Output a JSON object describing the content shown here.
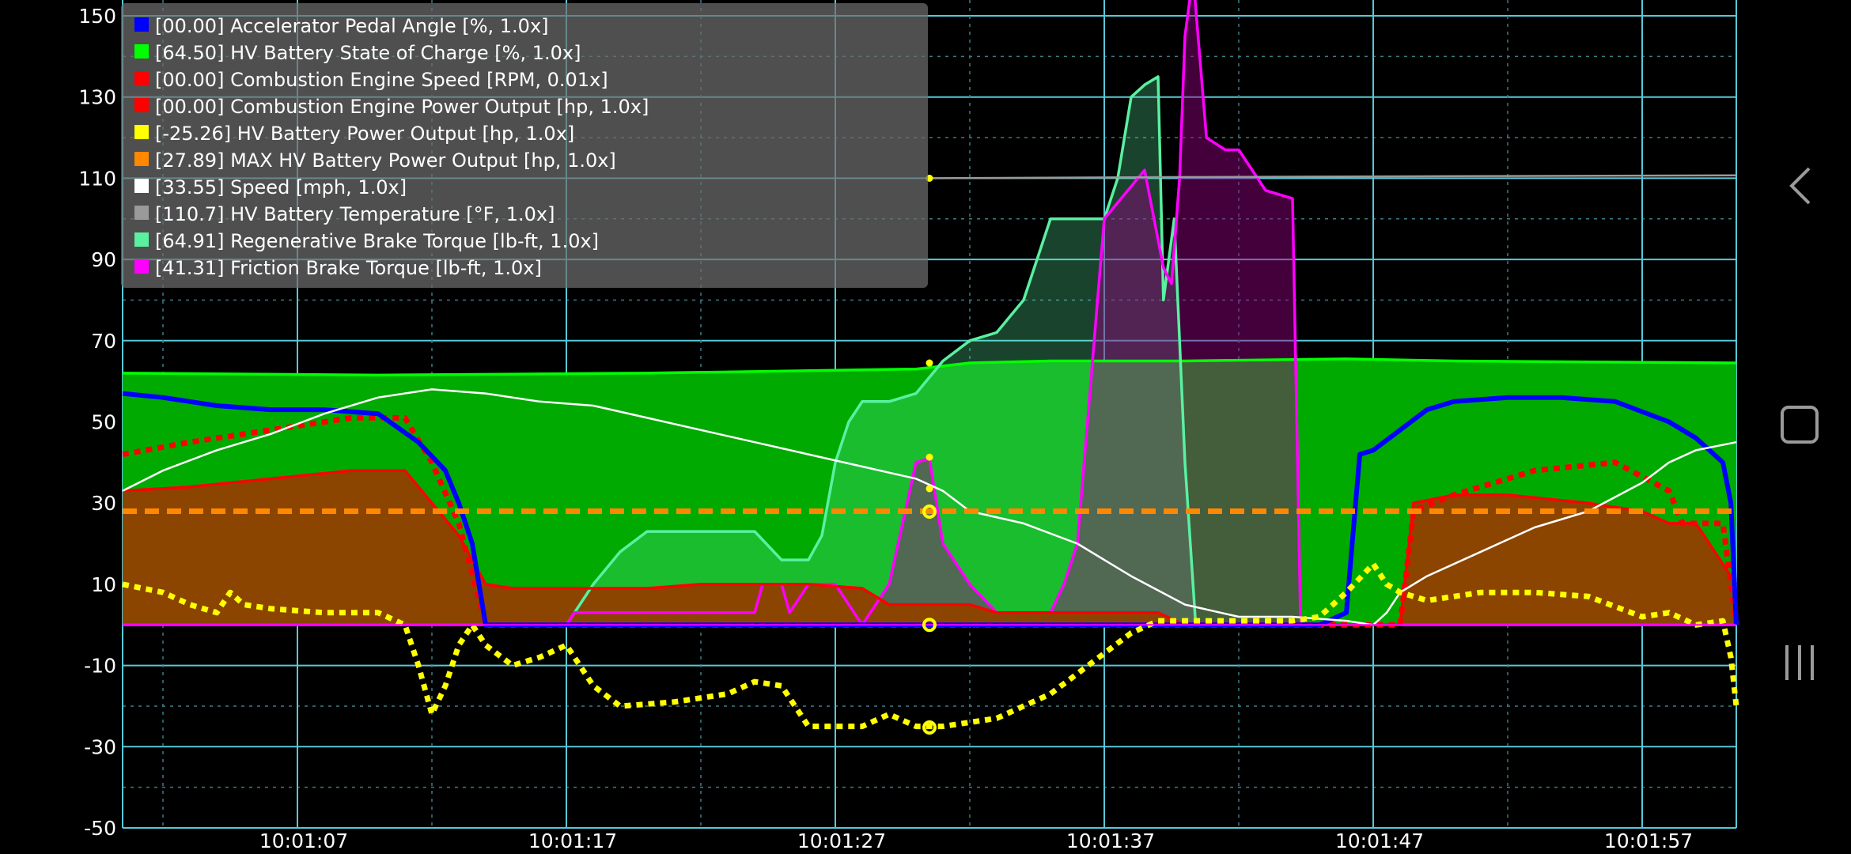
{
  "chart_data": {
    "type": "area",
    "ylim": [
      -50,
      150
    ],
    "yticks": [
      "-50",
      "-30",
      "-10",
      "10",
      "30",
      "50",
      "70",
      "90",
      "110",
      "130",
      "150"
    ],
    "x_ticks": [
      "10:01:07",
      "10:01:17",
      "10:01:27",
      "10:01:37",
      "10:01:47",
      "10:01:57"
    ],
    "x_range_s": [
      0.5,
      60.5
    ],
    "x_major_s": [
      7,
      17,
      27,
      37,
      47,
      57
    ],
    "cursor_s": 30.5,
    "grid": true,
    "legend_position": "top-left",
    "series": [
      {
        "name": "[64.50] HV Battery State of Charge [%, 1.0x]",
        "color": "#00ff00",
        "fill": "#00aa00",
        "style": "area",
        "points": [
          [
            0.5,
            62
          ],
          [
            10,
            61.5
          ],
          [
            20,
            62
          ],
          [
            30,
            63
          ],
          [
            32,
            64.5
          ],
          [
            35,
            65
          ],
          [
            40,
            65
          ],
          [
            46,
            65.5
          ],
          [
            50,
            65
          ],
          [
            60.5,
            64.5
          ]
        ]
      },
      {
        "name": "[64.91] Regenerative Brake Torque [lb-ft, 1.0x]",
        "color": "#5af0a0",
        "fill": "rgba(90,240,160,0.28)",
        "style": "area",
        "points": [
          [
            0.5,
            0
          ],
          [
            17,
            0
          ],
          [
            17.5,
            5
          ],
          [
            18,
            10
          ],
          [
            19,
            18
          ],
          [
            20,
            23
          ],
          [
            24,
            23
          ],
          [
            25,
            16
          ],
          [
            26,
            16
          ],
          [
            26.5,
            22
          ],
          [
            27,
            40
          ],
          [
            27.5,
            50
          ],
          [
            28,
            55
          ],
          [
            29,
            55
          ],
          [
            30,
            57
          ],
          [
            31,
            65
          ],
          [
            32,
            70
          ],
          [
            33,
            72
          ],
          [
            34,
            80
          ],
          [
            35,
            100
          ],
          [
            36,
            100
          ],
          [
            37,
            100
          ],
          [
            37.5,
            110
          ],
          [
            38,
            130
          ],
          [
            38.5,
            133
          ],
          [
            39,
            135
          ],
          [
            39.2,
            80
          ],
          [
            39.6,
            100
          ],
          [
            40,
            40
          ],
          [
            40.4,
            0
          ],
          [
            60.5,
            0
          ]
        ]
      },
      {
        "name": "[41.31] Friction Brake Torque [lb-ft, 1.0x]",
        "color": "#ff00ff",
        "fill": "rgba(150,0,130,0.45)",
        "style": "area",
        "points": [
          [
            0.5,
            0
          ],
          [
            17,
            0
          ],
          [
            17.3,
            3
          ],
          [
            24,
            3
          ],
          [
            24.3,
            10
          ],
          [
            25,
            10
          ],
          [
            25.3,
            3
          ],
          [
            26,
            10
          ],
          [
            27,
            10
          ],
          [
            27.5,
            5
          ],
          [
            28,
            0
          ],
          [
            29,
            10
          ],
          [
            30,
            40
          ],
          [
            30.5,
            41
          ],
          [
            31,
            20
          ],
          [
            32,
            10
          ],
          [
            33,
            3
          ],
          [
            35,
            3
          ],
          [
            35.5,
            10
          ],
          [
            36,
            20
          ],
          [
            37,
            100
          ],
          [
            38,
            108
          ],
          [
            38.5,
            112
          ],
          [
            39.2,
            88
          ],
          [
            39.5,
            84
          ],
          [
            39.8,
            110
          ],
          [
            40,
            145
          ],
          [
            40.3,
            160
          ],
          [
            40.8,
            120
          ],
          [
            41.5,
            117
          ],
          [
            42,
            117
          ],
          [
            43,
            107
          ],
          [
            44,
            105
          ],
          [
            44.3,
            0
          ],
          [
            60.5,
            0
          ]
        ]
      },
      {
        "name": "[00.00] Combustion Engine Power Output [hp, 1.0x]",
        "color": "#ff0000",
        "fill": "#8b4500",
        "style": "area",
        "points": [
          [
            0.5,
            33
          ],
          [
            3,
            34
          ],
          [
            6,
            36
          ],
          [
            9,
            38
          ],
          [
            11,
            38
          ],
          [
            12,
            30
          ],
          [
            13,
            22
          ],
          [
            14,
            10
          ],
          [
            15,
            9
          ],
          [
            17,
            9
          ],
          [
            20,
            9
          ],
          [
            22,
            10
          ],
          [
            24,
            10
          ],
          [
            26,
            10
          ],
          [
            28,
            9
          ],
          [
            29,
            5
          ],
          [
            30,
            5
          ],
          [
            32,
            5
          ],
          [
            33,
            3
          ],
          [
            35,
            3
          ],
          [
            37,
            3
          ],
          [
            38,
            3
          ],
          [
            39,
            3
          ],
          [
            40,
            0
          ],
          [
            43,
            0
          ],
          [
            45,
            0
          ],
          [
            46,
            0
          ],
          [
            47,
            0
          ],
          [
            48,
            0
          ],
          [
            48.5,
            30
          ],
          [
            50,
            32
          ],
          [
            52,
            32
          ],
          [
            55,
            30
          ],
          [
            57,
            28
          ],
          [
            58,
            25
          ],
          [
            59,
            25
          ],
          [
            60.5,
            10
          ]
        ]
      },
      {
        "name": "[00.00] Combustion Engine Speed [RPM, 0.01x]",
        "color": "#ff0000",
        "style": "dotted",
        "points": [
          [
            0.5,
            42
          ],
          [
            3,
            45
          ],
          [
            6,
            48
          ],
          [
            9,
            51
          ],
          [
            11,
            51
          ],
          [
            12,
            40
          ],
          [
            13,
            25
          ],
          [
            14,
            0
          ],
          [
            30,
            0
          ],
          [
            45,
            0
          ],
          [
            47,
            0
          ],
          [
            48,
            0
          ],
          [
            48.5,
            28
          ],
          [
            50,
            32
          ],
          [
            53,
            38
          ],
          [
            56,
            40
          ],
          [
            58,
            33
          ],
          [
            58.5,
            25
          ],
          [
            60,
            25
          ],
          [
            60.5,
            0
          ]
        ]
      },
      {
        "name": "[00.00] Accelerator Pedal Angle [%, 1.0x]",
        "color": "#0000ff",
        "style": "line",
        "points": [
          [
            0.5,
            57
          ],
          [
            2,
            56
          ],
          [
            4,
            54
          ],
          [
            6,
            53
          ],
          [
            8,
            53
          ],
          [
            10,
            52
          ],
          [
            11.5,
            45
          ],
          [
            12.5,
            38
          ],
          [
            13,
            30
          ],
          [
            13.5,
            20
          ],
          [
            14,
            0
          ],
          [
            45,
            0
          ],
          [
            46,
            3
          ],
          [
            46.5,
            42
          ],
          [
            47,
            43
          ],
          [
            48,
            48
          ],
          [
            49,
            53
          ],
          [
            50,
            55
          ],
          [
            52,
            56
          ],
          [
            54,
            56
          ],
          [
            56,
            55
          ],
          [
            58,
            50
          ],
          [
            59,
            46
          ],
          [
            60,
            40
          ],
          [
            60.3,
            30
          ],
          [
            60.5,
            0
          ]
        ]
      },
      {
        "name": "[33.55] Speed [mph, 1.0x]",
        "color": "#ffffff",
        "style": "line",
        "points": [
          [
            0.5,
            33
          ],
          [
            2,
            38
          ],
          [
            4,
            43
          ],
          [
            6,
            47
          ],
          [
            8,
            52
          ],
          [
            10,
            56
          ],
          [
            12,
            58
          ],
          [
            14,
            57
          ],
          [
            16,
            55
          ],
          [
            18,
            54
          ],
          [
            20,
            51
          ],
          [
            22,
            48
          ],
          [
            24,
            45
          ],
          [
            26,
            42
          ],
          [
            28,
            39
          ],
          [
            30,
            36
          ],
          [
            31,
            33
          ],
          [
            32,
            28
          ],
          [
            34,
            25
          ],
          [
            36,
            20
          ],
          [
            38,
            12
          ],
          [
            40,
            5
          ],
          [
            42,
            2
          ],
          [
            44,
            2
          ],
          [
            46,
            1
          ],
          [
            47,
            0
          ],
          [
            47.5,
            3
          ],
          [
            48,
            8
          ],
          [
            49,
            12
          ],
          [
            51,
            18
          ],
          [
            53,
            24
          ],
          [
            55,
            28
          ],
          [
            57,
            35
          ],
          [
            58,
            40
          ],
          [
            59,
            43
          ],
          [
            60.5,
            45
          ]
        ]
      },
      {
        "name": "[-25.26] HV Battery Power Output [hp, 1.0x]",
        "color": "#ffff00",
        "style": "dotted",
        "points": [
          [
            0.5,
            10
          ],
          [
            2,
            8
          ],
          [
            3,
            5
          ],
          [
            4,
            3
          ],
          [
            4.5,
            8
          ],
          [
            5,
            5
          ],
          [
            6,
            4
          ],
          [
            8,
            3
          ],
          [
            10,
            3
          ],
          [
            11,
            0
          ],
          [
            11.5,
            -10
          ],
          [
            12,
            -22
          ],
          [
            12.5,
            -15
          ],
          [
            13,
            -5
          ],
          [
            13.5,
            0
          ],
          [
            14,
            -5
          ],
          [
            15,
            -10
          ],
          [
            16,
            -8
          ],
          [
            17,
            -5
          ],
          [
            18,
            -15
          ],
          [
            19,
            -20
          ],
          [
            21,
            -19
          ],
          [
            23,
            -17
          ],
          [
            24,
            -14
          ],
          [
            25,
            -15
          ],
          [
            26,
            -25
          ],
          [
            27,
            -25
          ],
          [
            28,
            -25
          ],
          [
            29,
            -22
          ],
          [
            30,
            -25
          ],
          [
            31,
            -25
          ],
          [
            32,
            -24
          ],
          [
            33,
            -23
          ],
          [
            34,
            -20
          ],
          [
            35,
            -17
          ],
          [
            36,
            -12
          ],
          [
            37,
            -7
          ],
          [
            38,
            -2
          ],
          [
            39,
            1
          ],
          [
            41,
            1
          ],
          [
            43,
            1
          ],
          [
            44,
            1
          ],
          [
            45,
            2
          ],
          [
            46,
            8
          ],
          [
            47,
            15
          ],
          [
            47.5,
            10
          ],
          [
            48,
            8
          ],
          [
            49,
            6
          ],
          [
            51,
            8
          ],
          [
            53,
            8
          ],
          [
            55,
            7
          ],
          [
            57,
            2
          ],
          [
            58,
            3
          ],
          [
            59,
            0
          ],
          [
            60,
            1
          ],
          [
            60.3,
            -8
          ],
          [
            60.5,
            -20
          ]
        ]
      },
      {
        "name": "[27.89] MAX HV Battery Power Output [hp, 1.0x]",
        "color": "#ff8800",
        "style": "dashed",
        "points": [
          [
            0.5,
            28
          ],
          [
            60.5,
            28
          ]
        ]
      },
      {
        "name": "[110.7] HV Battery Temperature [°F, 1.0x]",
        "color": "#9a9a9a",
        "style": "line",
        "points": [
          [
            30.5,
            110
          ],
          [
            40,
            110.3
          ],
          [
            50,
            110.5
          ],
          [
            60.5,
            110.7
          ]
        ]
      }
    ],
    "legend": [
      {
        "label": "[00.00] Accelerator Pedal Angle [%, 1.0x]",
        "color": "#0000ff"
      },
      {
        "label": "[64.50] HV Battery State of Charge [%, 1.0x]",
        "color": "#00ff00"
      },
      {
        "label": "[00.00] Combustion Engine Speed [RPM, 0.01x]",
        "color": "#ff0000"
      },
      {
        "label": "[00.00] Combustion Engine Power Output [hp, 1.0x]",
        "color": "#ff0000"
      },
      {
        "label": "[-25.26] HV Battery Power Output [hp, 1.0x]",
        "color": "#ffff00"
      },
      {
        "label": "[27.89] MAX HV Battery Power Output [hp, 1.0x]",
        "color": "#ff8800"
      },
      {
        "label": "[33.55] Speed [mph, 1.0x]",
        "color": "#ffffff"
      },
      {
        "label": "[110.7] HV Battery Temperature [°F, 1.0x]",
        "color": "#9a9a9a"
      },
      {
        "label": "[64.91] Regenerative Brake Torque [lb-ft, 1.0x]",
        "color": "#5af0a0"
      },
      {
        "label": "[41.31] Friction Brake Torque [lb-ft, 1.0x]",
        "color": "#ff00ff"
      }
    ],
    "cursor_markers": [
      {
        "value": 110,
        "series": "HV Battery Temperature"
      },
      {
        "value": 64.5,
        "series": "HV Battery State of Charge"
      },
      {
        "value": 41.31,
        "series": "Friction Brake Torque"
      },
      {
        "value": 33.55,
        "series": "Speed"
      },
      {
        "value": 27.89,
        "series": "MAX HV Battery Power Output"
      },
      {
        "value": 0,
        "series": "Combustion Engine"
      },
      {
        "value": -25.26,
        "series": "HV Battery Power Output"
      }
    ]
  },
  "navbar": {
    "back_icon": "chevron-left-icon",
    "home_icon": "square-home-icon",
    "recents_icon": "three-bars-icon"
  }
}
